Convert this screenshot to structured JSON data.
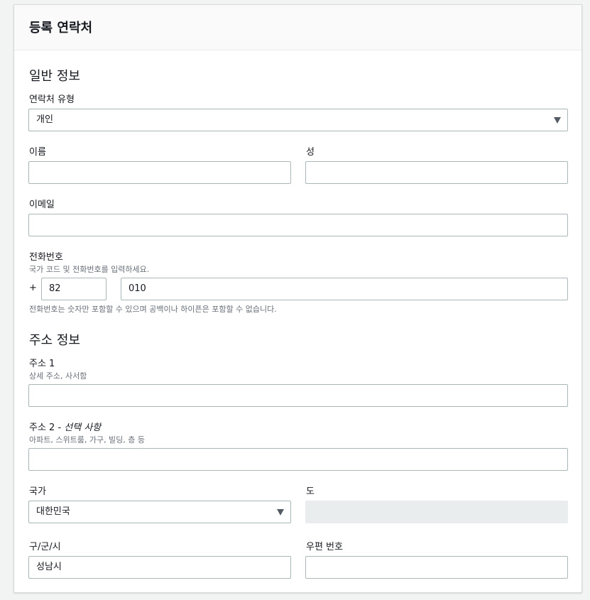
{
  "header": {
    "title": "등록 연락처"
  },
  "general": {
    "title": "일반 정보",
    "contact_type": {
      "label": "연락처 유형",
      "value": "개인"
    },
    "first_name": {
      "label": "이름",
      "value": ""
    },
    "last_name": {
      "label": "성",
      "value": ""
    },
    "email": {
      "label": "이메일",
      "value": ""
    },
    "phone": {
      "label": "전화번호",
      "description": "국가 코드 및 전화번호를 입력하세요.",
      "plus": "+",
      "country_code": "82",
      "number": "010",
      "hint": "전화번호는 숫자만 포함할 수 있으며 공백이나 하이픈은 포함할 수 없습니다."
    }
  },
  "address": {
    "title": "주소 정보",
    "line1": {
      "label": "주소 1",
      "description": "상세 주소, 사서함",
      "value": ""
    },
    "line2": {
      "label": "주소 2 - ",
      "optional": "선택 사항",
      "description": "아파트, 스위트룸, 가구, 빌딩, 층 등",
      "value": ""
    },
    "country": {
      "label": "국가",
      "value": "대한민국"
    },
    "state": {
      "label": "도",
      "value": ""
    },
    "city": {
      "label": "구/군/시",
      "value": "성남시"
    },
    "postal": {
      "label": "우편 번호",
      "value": ""
    }
  }
}
